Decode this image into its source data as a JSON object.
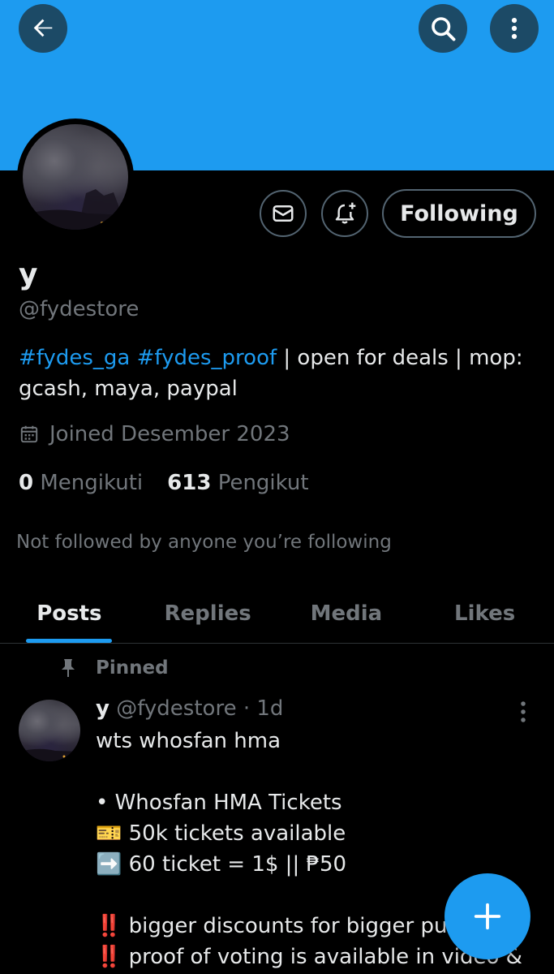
{
  "profile": {
    "name": "y",
    "handle": "@fydestore",
    "bio": {
      "tag1": "#fydes_ga",
      "tag2": "#fydes_proof",
      "text": " | open for deals | mop: gcash, maya, paypal"
    },
    "joined": "Joined Desember 2023",
    "following_count": "0",
    "following_label": "Mengikuti",
    "followers_count": "613",
    "followers_label": "Pengikut",
    "not_followed": "Not followed by anyone you’re following",
    "follow_button": "Following"
  },
  "tabs": [
    {
      "label": "Posts",
      "active": true
    },
    {
      "label": "Replies",
      "active": false
    },
    {
      "label": "Media",
      "active": false
    },
    {
      "label": "Likes",
      "active": false
    }
  ],
  "post": {
    "pinned_label": "Pinned",
    "author_name": "y",
    "author_handle": "@fydestore",
    "time": "· 1d",
    "text": "wts whosfan hma\n\n• Whosfan HMA Tickets\n🎫 50k tickets available\n➡️ 60 ticket = 1$ || ₱50\n\n‼️ bigger discounts for bigger pu\n‼️ proof of voting is available in video &"
  },
  "icons": {
    "back": "back-arrow-icon",
    "search": "search-icon",
    "more": "more-vertical-icon",
    "message": "mail-icon",
    "notify": "bell-plus-icon",
    "calendar": "calendar-icon",
    "pin": "pin-icon",
    "compose": "plus-icon"
  },
  "colors": {
    "accent": "#1d9bf0",
    "background": "#000000",
    "text": "#e7e9ea",
    "muted": "#71767b"
  }
}
